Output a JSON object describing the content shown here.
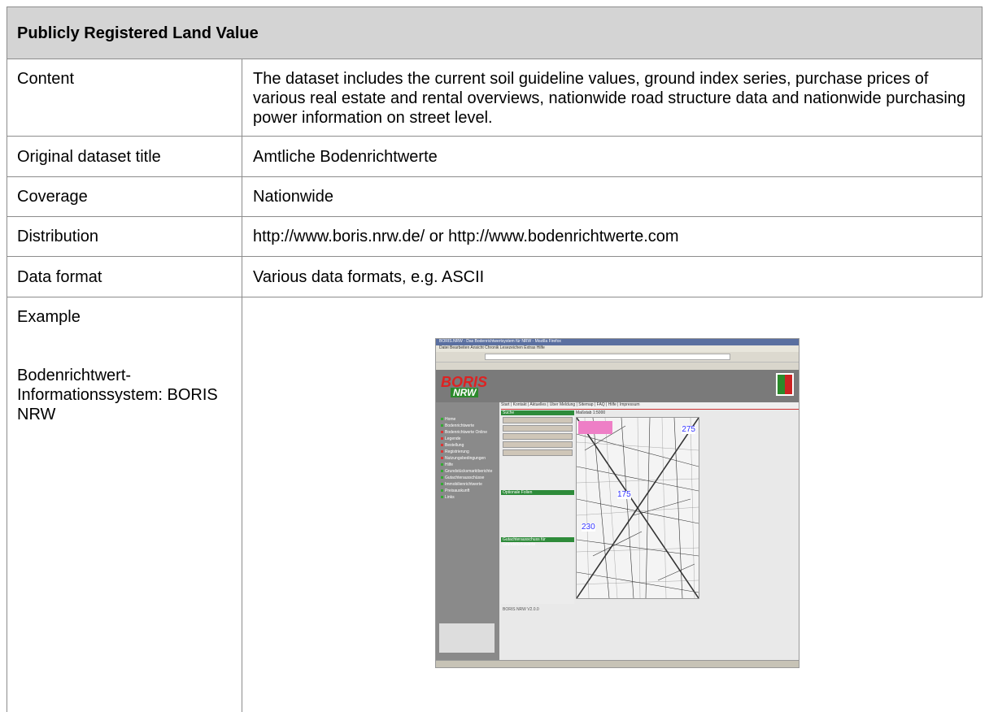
{
  "table": {
    "title": "Publicly Registered Land Value",
    "rows": [
      {
        "label": "Content",
        "value": "The dataset includes the current soil guideline values, ground index series, purchase prices of various real estate and rental overviews, nationwide road structure data and nationwide purchasing power information on street level."
      },
      {
        "label": "Original dataset title",
        "value": "Amtliche Bodenrichtwerte"
      },
      {
        "label": "Coverage",
        "value": "Nationwide"
      },
      {
        "label": "Distribution",
        "value": "http://www.boris.nrw.de/ or http://www.bodenrichtwerte.com"
      },
      {
        "label": "Data format",
        "value": "Various data formats, e.g. ASCII"
      }
    ],
    "example": {
      "label": "Example",
      "caption": "Bodenrichtwert-Informationssystem: BORIS NRW"
    }
  },
  "screenshot": {
    "window_title": "BORIS.NRW - Das Bodenrichtwertsystem für NRW - Mozilla Firefox",
    "menu": "Datei  Bearbeiten  Ansicht  Chronik  Lesezeichen  Extras  Hilfe",
    "logo_top": "BORIS",
    "logo_bottom": "NRW",
    "tabs": "Start | Kontakt | Aktuelles | Über Meldung | Sitemap | FAQ | Hilfe | Impressum",
    "scale_label": "Maßstab 1:5000",
    "map_labels": [
      "275",
      "175",
      "230"
    ],
    "sidebar_items": [
      {
        "text": "Home",
        "red": false
      },
      {
        "text": "Bodenrichtwerte",
        "red": false
      },
      {
        "text": "Bodenrichtwerte Online",
        "red": true
      },
      {
        "text": "Legende",
        "red": true
      },
      {
        "text": "Bestellung",
        "red": true
      },
      {
        "text": "Registrierung",
        "red": true
      },
      {
        "text": "Nutzungsbedingungen",
        "red": true
      },
      {
        "text": "Hilfe",
        "red": false
      },
      {
        "text": "Grundstücksmarktberichte",
        "red": false
      },
      {
        "text": "Gutachterausschüsse",
        "red": false
      },
      {
        "text": "Immobilienrichtwerte",
        "red": false
      },
      {
        "text": "Preisauskunft",
        "red": false
      },
      {
        "text": "Links",
        "red": false
      }
    ],
    "panel_headers": [
      "Suche",
      "Optionale Folien",
      "Gutachterausschuss für Grundstückswerte"
    ],
    "footer_text": "BORIS NRW V2.0.0",
    "colors": {
      "green": "#2e8b3a",
      "red": "#d22222",
      "gray": "#8a8a8a",
      "pink": "#ee7fc6"
    }
  }
}
